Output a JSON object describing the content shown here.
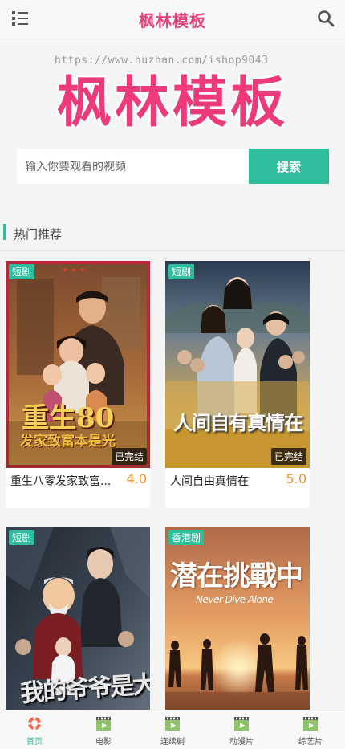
{
  "header": {
    "title": "枫林模板",
    "menu_icon": "menu-list-icon",
    "search_icon": "search-icon"
  },
  "banner": {
    "watermark": "https://www.huzhan.com/ishop9043",
    "logo_text": "枫林模板"
  },
  "search": {
    "placeholder": "输入你要观看的视频",
    "button_label": "搜索"
  },
  "section": {
    "title": "热门推荐"
  },
  "cards": [
    {
      "tag": "短剧",
      "status": "已完结",
      "title": "重生八零发家致富...",
      "score": "4.0"
    },
    {
      "tag": "短剧",
      "status": "已完结",
      "title": "人间自由真情在",
      "score": "5.0"
    },
    {
      "tag": "短剧",
      "status": "",
      "title": "",
      "score": ""
    },
    {
      "tag": "香港剧",
      "status": "",
      "title": "",
      "score": ""
    }
  ],
  "posters": [
    {
      "overlay_text": "重生80",
      "subtitle": "发家致富本是光"
    },
    {
      "overlay_text": "人间自有真情在",
      "subtitle": ""
    },
    {
      "overlay_text": "我的爷爷是大侠",
      "subtitle": ""
    },
    {
      "overlay_text": "潜在挑戰中",
      "subtitle": "Never Dive Alone"
    }
  ],
  "bottom_nav": [
    {
      "label": "首页",
      "icon": "home-lifebuoy-icon",
      "active": true
    },
    {
      "label": "电影",
      "icon": "film-icon",
      "active": false
    },
    {
      "label": "连续剧",
      "icon": "tv-series-icon",
      "active": false
    },
    {
      "label": "动漫片",
      "icon": "anime-icon",
      "active": false
    },
    {
      "label": "综艺片",
      "icon": "variety-icon",
      "active": false
    }
  ],
  "colors": {
    "accent": "#2fbd9d",
    "brand": "#ec3a7a",
    "score": "#f0932b"
  }
}
